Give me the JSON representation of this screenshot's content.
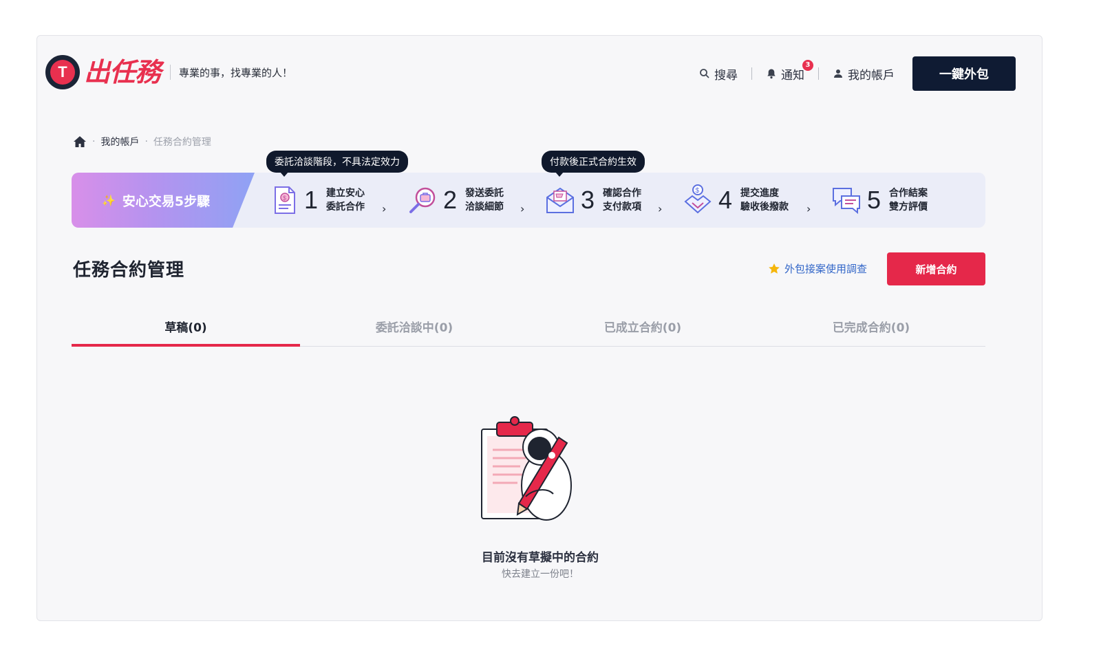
{
  "brand": {
    "logo_letter": "T",
    "logo_text": "出任務",
    "tagline": "專業的事，找專業的人！",
    "accent": "#e8304f"
  },
  "nav": {
    "search": "搜尋",
    "notify": "通知",
    "notify_count": "3",
    "account": "我的帳戶",
    "outsource": "一鍵外包"
  },
  "breadcrumb": {
    "home_icon": "home-icon",
    "items": [
      "我的帳戶",
      "任務合約管理"
    ]
  },
  "steps": {
    "header": "安心交易5步驟",
    "tips": [
      "委託洽談階段，不具法定效力",
      "付款後正式合約生效"
    ],
    "items": [
      {
        "num": "1",
        "line1": "建立安心",
        "line2": "委託合作",
        "icon": "document-dollar-icon"
      },
      {
        "num": "2",
        "line1": "發送委託",
        "line2": "洽談細節",
        "icon": "magnifier-briefcase-icon"
      },
      {
        "num": "3",
        "line1": "確認合作",
        "line2": "支付款項",
        "icon": "envelope-cart-icon"
      },
      {
        "num": "4",
        "line1": "提交進度",
        "line2": "驗收後撥款",
        "icon": "handshake-coin-icon"
      },
      {
        "num": "5",
        "line1": "合作結案",
        "line2": "雙方評價",
        "icon": "chat-bubbles-icon"
      }
    ]
  },
  "page": {
    "title": "任務合約管理",
    "survey": "外包接案使用調查",
    "new_button": "新增合約"
  },
  "tabs": [
    "草稿(0)",
    "委託洽談中(0)",
    "已成立合約(0)",
    "已完成合約(0)"
  ],
  "empty": {
    "title": "目前沒有草擬中的合約",
    "subtitle": "快去建立一份吧！"
  }
}
